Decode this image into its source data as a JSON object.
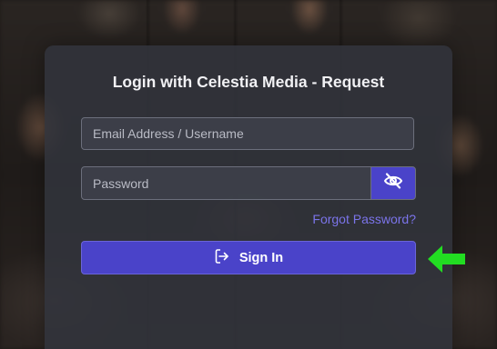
{
  "login": {
    "title": "Login with Celestia Media - Request",
    "email_placeholder": "Email Address / Username",
    "password_placeholder": "Password",
    "forgot_label": "Forgot Password?",
    "signin_label": "Sign In"
  },
  "colors": {
    "accent": "#4a43c9",
    "link": "#7b74ea",
    "pointer_arrow": "#22dd22"
  },
  "icons": {
    "password_toggle": "eye-slash-icon",
    "signin": "sign-in-icon",
    "annotation": "arrow-left-icon"
  }
}
